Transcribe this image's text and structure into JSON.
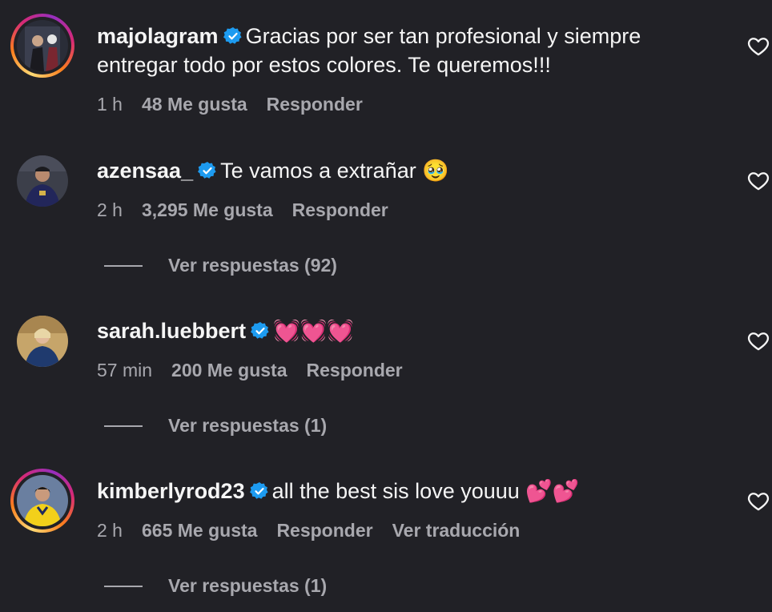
{
  "comments": [
    {
      "username": "majolagram",
      "text": "Gracias por ser tan profesional y siempre entregar todo por estos colores. Te queremos!!!",
      "time": "1 h",
      "likes": "48 Me gusta",
      "reply": "Responder"
    },
    {
      "username": "azensaa_",
      "text": "Te vamos a extrañar",
      "emoji": "🥹",
      "time": "2 h",
      "likes": "3,295 Me gusta",
      "reply": "Responder",
      "view_replies": "Ver respuestas (92)"
    },
    {
      "username": "sarah.luebbert",
      "text": "",
      "emoji": "💓💓💓",
      "time": "57 min",
      "likes": "200 Me gusta",
      "reply": "Responder",
      "view_replies": "Ver respuestas (1)"
    },
    {
      "username": "kimberlyrod23",
      "text": "all the best sis love youuu",
      "emoji": "💕💕",
      "time": "2 h",
      "likes": "665 Me gusta",
      "reply": "Responder",
      "translate": "Ver traducción",
      "view_replies": "Ver respuestas (1)"
    }
  ],
  "colors": {
    "background": "#212126",
    "text": "#f5f5f5",
    "meta": "#a8a8ae",
    "verified": "#1d9bf0"
  }
}
